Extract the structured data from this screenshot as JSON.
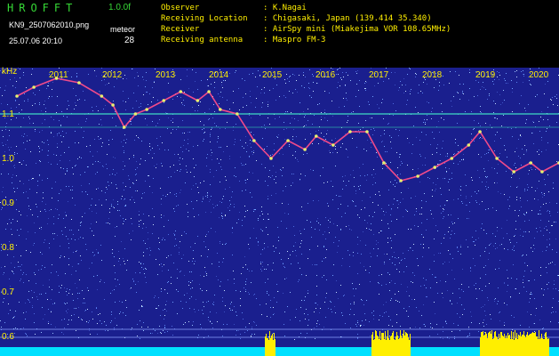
{
  "header": {
    "logo": "HROFFT",
    "version": "1.0.0f",
    "filename": "KN9_2507062010.png",
    "mode_label": "meteor",
    "datetime": "25.07.06 20:10",
    "count": "28"
  },
  "info": {
    "rows": [
      {
        "label": "Observer",
        "value": ": K.Nagai"
      },
      {
        "label": "Receiving Location",
        "value": ": Chigasaki, Japan (139.414 35.340)"
      },
      {
        "label": "Receiver",
        "value": ": AirSpy mini (Miakejima VOR 108.65MHz)"
      },
      {
        "label": "Receiving antenna",
        "value": ": Maspro FM-3"
      }
    ]
  },
  "axis": {
    "unit": "kHz",
    "y_ticks": [
      "1.1",
      "1.0",
      "0.9",
      "0.8",
      "0.7",
      "0.6"
    ],
    "years": [
      "2011",
      "2012",
      "2013",
      "2014",
      "2015",
      "2016",
      "2017",
      "2018",
      "2019",
      "2020"
    ]
  },
  "colors": {
    "background": "#000000",
    "spectrum_bg": "#1a1f8e",
    "trace": "#f04a8a",
    "ref_line": "#3fd9c4",
    "baseline": "#00e0ff",
    "burst": "#ffef00"
  },
  "chart_data": {
    "type": "line",
    "title": "",
    "xlabel": "",
    "ylabel": "kHz",
    "x": [
      2010.7,
      2011.0,
      2011.4,
      2011.8,
      2012.2,
      2012.4,
      2012.6,
      2012.8,
      2013.0,
      2013.3,
      2013.6,
      2013.9,
      2014.1,
      2014.3,
      2014.6,
      2014.9,
      2015.2,
      2015.5,
      2015.8,
      2016.0,
      2016.3,
      2016.6,
      2016.9,
      2017.2,
      2017.5,
      2017.8,
      2018.1,
      2018.4,
      2018.7,
      2018.9,
      2019.2,
      2019.5,
      2019.8,
      2020.0,
      2020.3
    ],
    "y": [
      1.14,
      1.16,
      1.18,
      1.17,
      1.14,
      1.12,
      1.07,
      1.1,
      1.11,
      1.13,
      1.15,
      1.13,
      1.15,
      1.11,
      1.1,
      1.04,
      1.0,
      1.04,
      1.02,
      1.05,
      1.03,
      1.06,
      1.06,
      0.99,
      0.95,
      0.96,
      0.98,
      1.0,
      1.03,
      1.06,
      1.0,
      0.97,
      0.99,
      0.97,
      0.99
    ],
    "ylim": [
      0.59,
      1.17
    ],
    "xlim": [
      2010.4,
      2020.3
    ],
    "reference_line_y": 1.1
  }
}
